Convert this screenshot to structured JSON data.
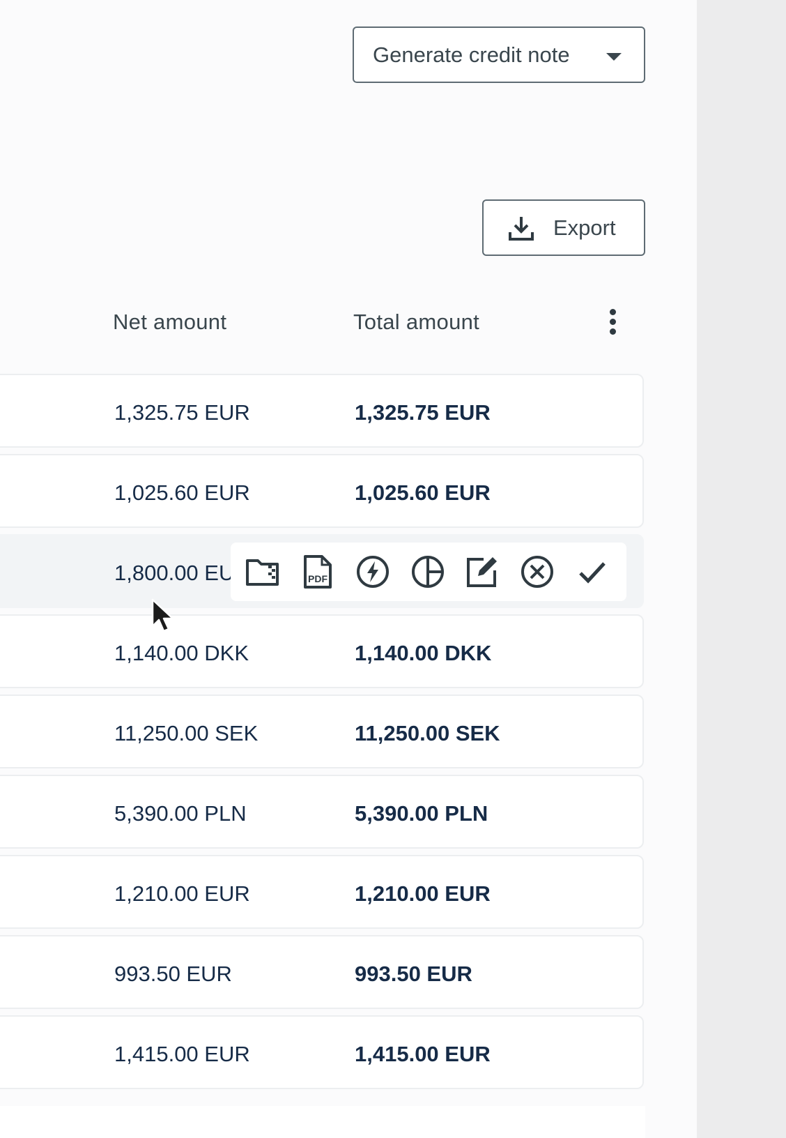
{
  "toolbar": {
    "generate_credit_note_label": "Generate credit note",
    "export_label": "Export"
  },
  "table": {
    "columns": {
      "net_amount": "Net amount",
      "total_amount": "Total amount"
    },
    "rows": [
      {
        "net": "1,325.75 EUR",
        "total": "1,325.75 EUR"
      },
      {
        "net": "1,025.60 EUR",
        "total": "1,025.60 EUR"
      },
      {
        "net": "1,800.00 EU",
        "total": ""
      },
      {
        "net": "1,140.00 DKK",
        "total": "1,140.00 DKK"
      },
      {
        "net": "11,250.00 SEK",
        "total": "11,250.00 SEK"
      },
      {
        "net": "5,390.00 PLN",
        "total": "5,390.00 PLN"
      },
      {
        "net": "1,210.00 EUR",
        "total": "1,210.00 EUR"
      },
      {
        "net": "993.50 EUR",
        "total": "993.50 EUR"
      },
      {
        "net": "1,415.00 EUR",
        "total": "1,415.00 EUR"
      }
    ]
  },
  "row_actions": {
    "icons": [
      "folder-zip-icon",
      "pdf-icon",
      "lightning-icon",
      "pie-chart-icon",
      "edit-icon",
      "cancel-icon",
      "check-icon"
    ],
    "pdf_text": "PDF"
  },
  "colors": {
    "text_primary": "#162b47",
    "icon": "#2f3a41",
    "border": "#5e6b73",
    "hover_row": "#f2f4f6"
  }
}
